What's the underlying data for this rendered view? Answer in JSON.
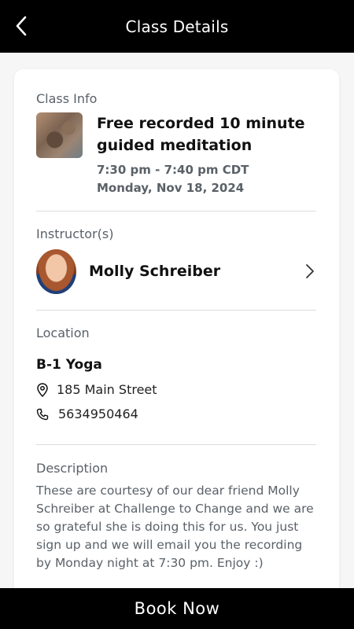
{
  "header": {
    "title": "Class Details",
    "back_icon": "chevron-left-icon"
  },
  "class_info": {
    "label": "Class Info",
    "title": "Free recorded 10 minute guided meditation",
    "time": "7:30 pm - 7:40 pm CDT",
    "date": "Monday, Nov 18, 2024"
  },
  "instructor": {
    "label": "Instructor(s)",
    "name": "Molly Schreiber"
  },
  "location": {
    "label": "Location",
    "name": "B-1 Yoga",
    "address": "185 Main Street",
    "phone": "5634950464"
  },
  "description": {
    "label": "Description",
    "text": "These are courtesy of our dear friend Molly Schreiber at Challenge to Change and we are so grateful she is doing this for us. You just sign up and we will email you the recording by Monday night at 7:30 pm. Enjoy :)"
  },
  "footer": {
    "book_label": "Book Now"
  },
  "colors": {
    "header_bg": "#000000",
    "muted_text": "#5a6168",
    "card_bg": "#ffffff"
  }
}
